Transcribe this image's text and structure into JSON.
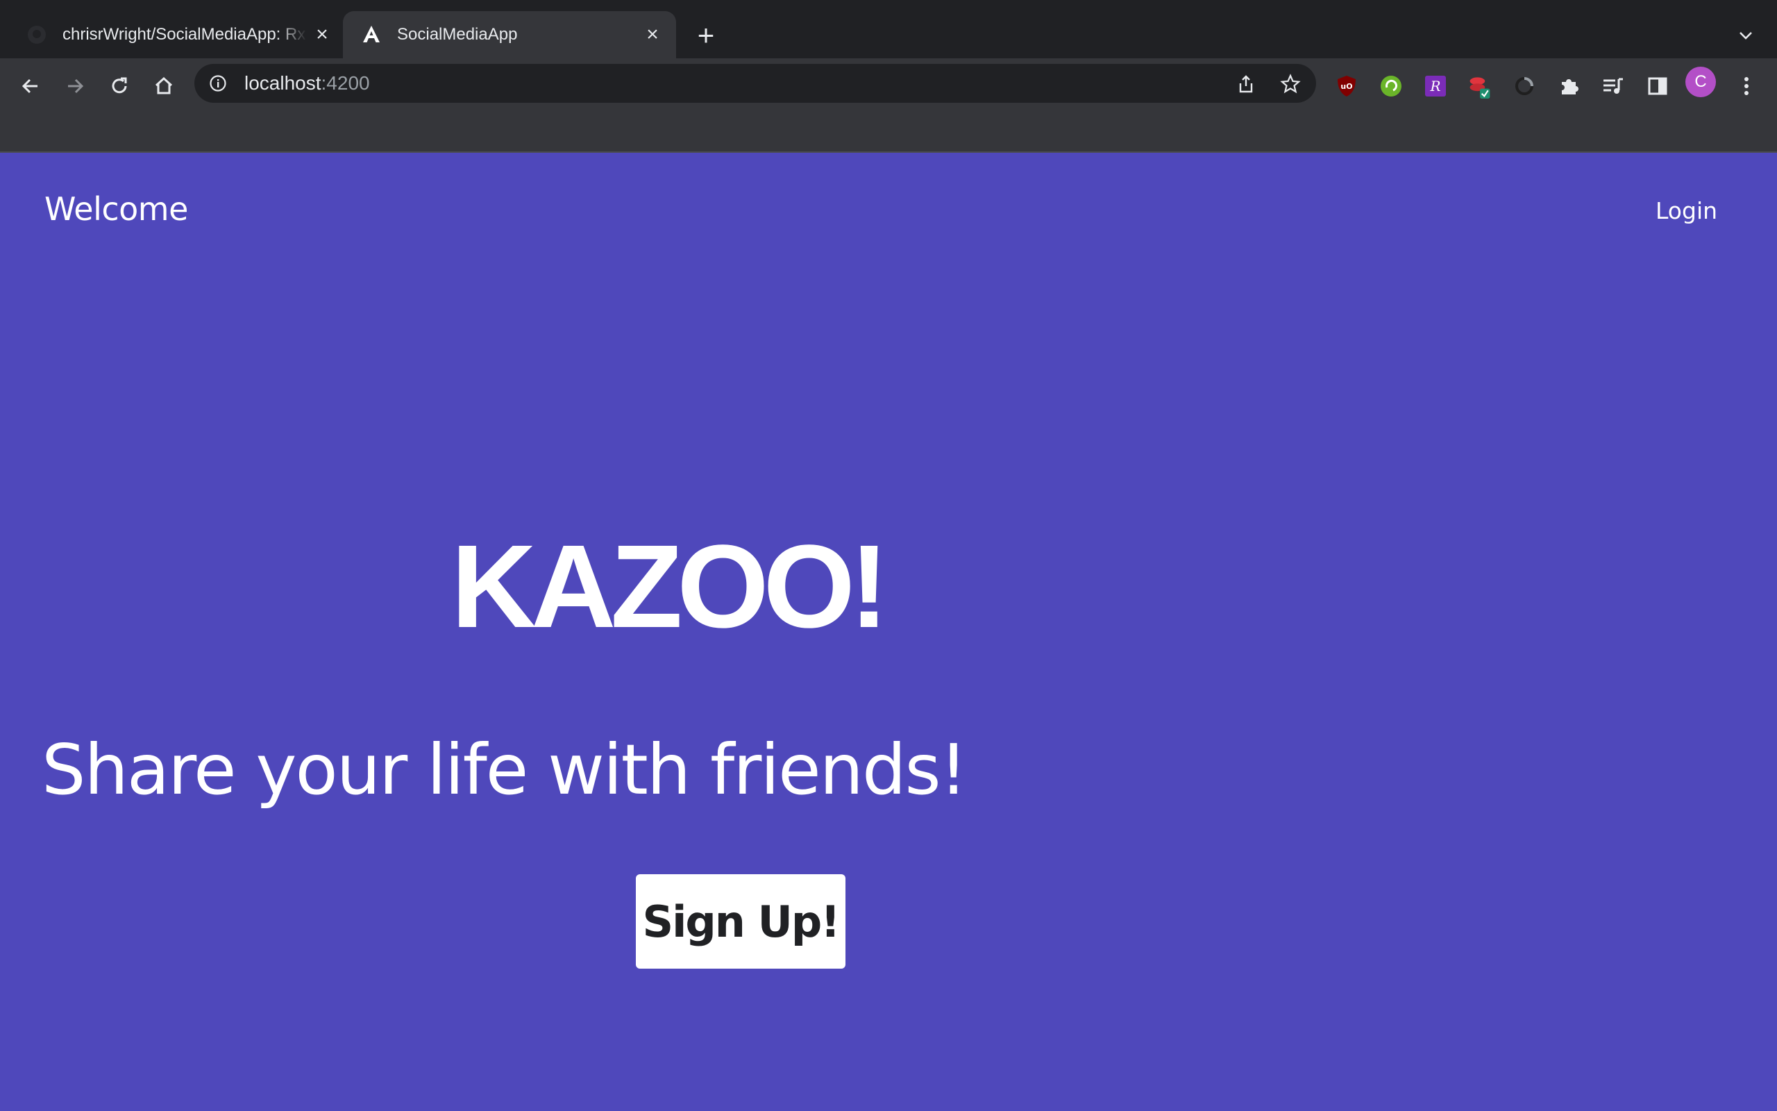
{
  "browser": {
    "tabs": [
      {
        "title": "chrisrWright/SocialMediaApp: Rx",
        "icon": "github-icon",
        "active": false
      },
      {
        "title": "SocialMediaApp",
        "icon": "angular-icon",
        "active": true
      }
    ],
    "new_tab_label": "+",
    "address": {
      "host": "localhost",
      "port": ":4200"
    },
    "profile_initial": "C",
    "colors": {
      "frame": "#202124",
      "toolbar": "#35363a",
      "profile": "#b34fc7"
    }
  },
  "app": {
    "header": {
      "title": "Welcome",
      "login_label": "Login"
    },
    "hero": {
      "title": "KAZOO!",
      "tagline": "Share your life with friends!"
    },
    "signup_label": "Sign Up!",
    "colors": {
      "background": "#4f48bb",
      "text": "#ffffff",
      "button_bg": "#ffffff",
      "button_text": "#202124"
    }
  }
}
